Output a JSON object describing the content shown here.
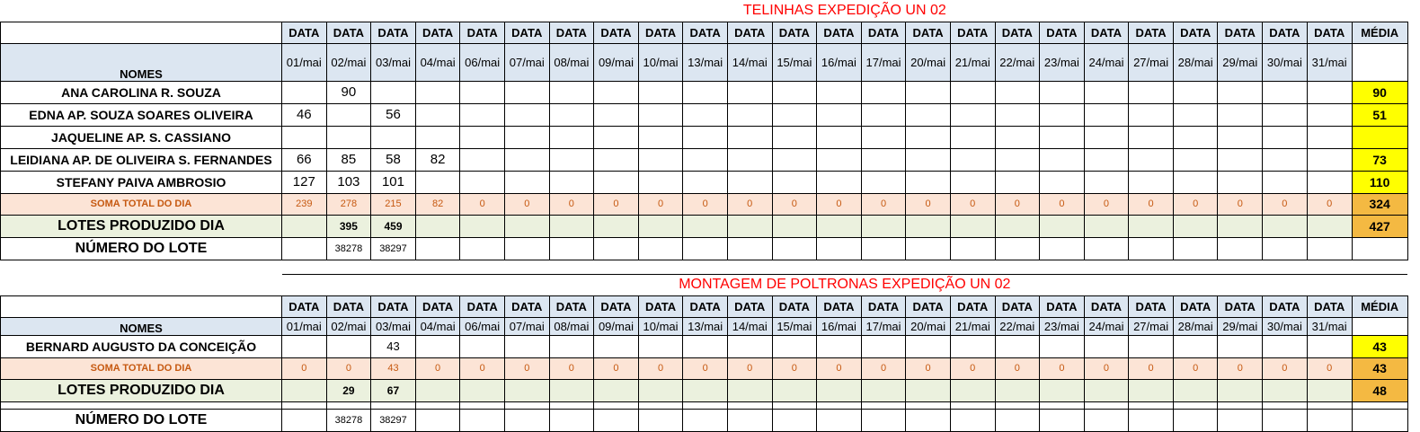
{
  "dates": [
    "01/mai",
    "02/mai",
    "03/mai",
    "04/mai",
    "06/mai",
    "07/mai",
    "08/mai",
    "09/mai",
    "10/mai",
    "13/mai",
    "14/mai",
    "15/mai",
    "16/mai",
    "17/mai",
    "20/mai",
    "21/mai",
    "22/mai",
    "23/mai",
    "24/mai",
    "27/mai",
    "28/mai",
    "29/mai",
    "30/mai",
    "31/mai"
  ],
  "date_header": "DATA",
  "media_header": "MÉDIA",
  "nomes_label": "NOMES",
  "section1": {
    "title": "TELINHAS EXPEDIÇÃO UN 02",
    "rows": [
      {
        "name": "ANA CAROLINA R. SOUZA",
        "values": [
          "",
          "90",
          "",
          "",
          "",
          "",
          "",
          "",
          "",
          "",
          "",
          "",
          "",
          "",
          "",
          "",
          "",
          "",
          "",
          "",
          "",
          "",
          "",
          ""
        ],
        "media": "90"
      },
      {
        "name": "EDNA AP. SOUZA SOARES OLIVEIRA",
        "values": [
          "46",
          "",
          "56",
          "",
          "",
          "",
          "",
          "",
          "",
          "",
          "",
          "",
          "",
          "",
          "",
          "",
          "",
          "",
          "",
          "",
          "",
          "",
          "",
          ""
        ],
        "media": "51"
      },
      {
        "name": "JAQUELINE AP.  S. CASSIANO",
        "values": [
          "",
          "",
          "",
          "",
          "",
          "",
          "",
          "",
          "",
          "",
          "",
          "",
          "",
          "",
          "",
          "",
          "",
          "",
          "",
          "",
          "",
          "",
          "",
          ""
        ],
        "media": ""
      },
      {
        "name": "LEIDIANA AP. DE OLIVEIRA S. FERNANDES",
        "values": [
          "66",
          "85",
          "58",
          "82",
          "",
          "",
          "",
          "",
          "",
          "",
          "",
          "",
          "",
          "",
          "",
          "",
          "",
          "",
          "",
          "",
          "",
          "",
          "",
          ""
        ],
        "media": "73"
      },
      {
        "name": "STEFANY PAIVA AMBROSIO",
        "values": [
          "127",
          "103",
          "101",
          "",
          "",
          "",
          "",
          "",
          "",
          "",
          "",
          "",
          "",
          "",
          "",
          "",
          "",
          "",
          "",
          "",
          "",
          "",
          "",
          ""
        ],
        "media": "110"
      }
    ],
    "soma": {
      "label": "SOMA TOTAL DO DIA",
      "values": [
        "239",
        "278",
        "215",
        "82",
        "0",
        "0",
        "0",
        "0",
        "0",
        "0",
        "0",
        "0",
        "0",
        "0",
        "0",
        "0",
        "0",
        "0",
        "0",
        "0",
        "0",
        "0",
        "0",
        "0"
      ],
      "media": "324"
    },
    "lotes": {
      "label": "LOTES PRODUZIDO DIA",
      "values": [
        "",
        "395",
        "459",
        "",
        "",
        "",
        "",
        "",
        "",
        "",
        "",
        "",
        "",
        "",
        "",
        "",
        "",
        "",
        "",
        "",
        "",
        "",
        "",
        ""
      ],
      "media": "427"
    },
    "numero": {
      "label": "NÚMERO DO LOTE",
      "values": [
        "",
        "38278",
        "38297",
        "",
        "",
        "",
        "",
        "",
        "",
        "",
        "",
        "",
        "",
        "",
        "",
        "",
        "",
        "",
        "",
        "",
        "",
        "",
        "",
        ""
      ]
    }
  },
  "section2": {
    "title": "MONTAGEM DE POLTRONAS EXPEDIÇÃO UN 02",
    "rows": [
      {
        "name": "BERNARD AUGUSTO DA CONCEIÇÃO",
        "values": [
          "",
          "",
          "43",
          "",
          "",
          "",
          "",
          "",
          "",
          "",
          "",
          "",
          "",
          "",
          "",
          "",
          "",
          "",
          "",
          "",
          "",
          "",
          "",
          ""
        ],
        "media": "43"
      }
    ],
    "soma": {
      "label": "SOMA TOTAL DO DIA",
      "values": [
        "0",
        "0",
        "43",
        "0",
        "0",
        "0",
        "0",
        "0",
        "0",
        "0",
        "0",
        "0",
        "0",
        "0",
        "0",
        "0",
        "0",
        "0",
        "0",
        "0",
        "0",
        "0",
        "0",
        "0"
      ],
      "media": "43"
    },
    "lotes": {
      "label": "LOTES PRODUZIDO DIA",
      "values": [
        "",
        "29",
        "67",
        "",
        "",
        "",
        "",
        "",
        "",
        "",
        "",
        "",
        "",
        "",
        "",
        "",
        "",
        "",
        "",
        "",
        "",
        "",
        "",
        ""
      ],
      "media": "48"
    },
    "numero": {
      "label": "NÚMERO DO LOTE",
      "values": [
        "",
        "38278",
        "38297",
        "",
        "",
        "",
        "",
        "",
        "",
        "",
        "",
        "",
        "",
        "",
        "",
        "",
        "",
        "",
        "",
        "",
        "",
        "",
        "",
        ""
      ]
    }
  }
}
